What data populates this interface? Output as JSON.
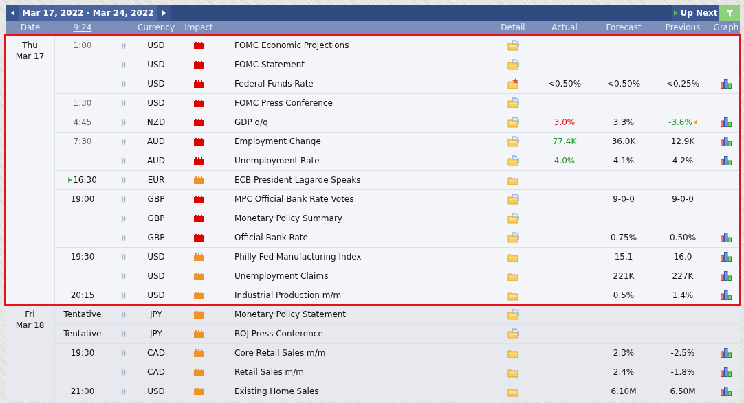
{
  "toolbar": {
    "date_range": "Mar 17, 2022 - Mar 24, 2022",
    "up_next": "Up Next"
  },
  "columns": [
    {
      "kind": "date",
      "label": "Date"
    },
    {
      "kind": "time",
      "label": "9:24"
    },
    {
      "kind": "currency",
      "label": "Currency"
    },
    {
      "kind": "impact",
      "label": "Impact"
    },
    {
      "kind": "detail",
      "label": "Detail"
    },
    {
      "kind": "actual",
      "label": "Actual"
    },
    {
      "kind": "forecast",
      "label": "Forecast"
    },
    {
      "kind": "previous",
      "label": "Previous"
    },
    {
      "kind": "graph",
      "label": "Graph"
    }
  ],
  "days": [
    {
      "weekday": "Thu",
      "date": "Mar 17",
      "highlighted": true,
      "slots": [
        {
          "time": "1:00",
          "past": true,
          "up_next": false,
          "events": [
            {
              "currency": "USD",
              "impact": {
                "color": "#e00000"
              },
              "title": "FOMC Economic Projections",
              "has_document": true,
              "starred": false,
              "graph": false
            },
            {
              "currency": "USD",
              "impact": {
                "color": "#e00000"
              },
              "title": "FOMC Statement",
              "has_document": true,
              "starred": false,
              "graph": false
            },
            {
              "currency": "USD",
              "impact": {
                "color": "#e00000"
              },
              "title": "Federal Funds Rate",
              "has_document": false,
              "starred": true,
              "actual": {
                "value": "<0.50%",
                "color": "#111111"
              },
              "forecast": "<0.50%",
              "previous": {
                "value": "<0.25%",
                "color": "#111111"
              },
              "revised": false,
              "graph": true
            }
          ]
        },
        {
          "time": "1:30",
          "past": true,
          "up_next": false,
          "events": [
            {
              "currency": "USD",
              "impact": {
                "color": "#e00000"
              },
              "title": "FOMC Press Conference",
              "has_document": true,
              "starred": false,
              "graph": false
            }
          ]
        },
        {
          "time": "4:45",
          "past": true,
          "up_next": false,
          "events": [
            {
              "currency": "NZD",
              "impact": {
                "color": "#e00000"
              },
              "title": "GDP q/q",
              "has_document": true,
              "starred": false,
              "actual": {
                "value": "3.0%",
                "color": "#e0141e"
              },
              "forecast": "3.3%",
              "previous": {
                "value": "-3.6%",
                "color": "#1a9a2a"
              },
              "revised": true,
              "graph": true
            }
          ]
        },
        {
          "time": "7:30",
          "past": true,
          "up_next": false,
          "events": [
            {
              "currency": "AUD",
              "impact": {
                "color": "#e00000"
              },
              "title": "Employment Change",
              "has_document": true,
              "starred": false,
              "actual": {
                "value": "77.4K",
                "color": "#1a9a2a"
              },
              "forecast": "36.0K",
              "previous": {
                "value": "12.9K",
                "color": "#111111"
              },
              "revised": false,
              "graph": true
            },
            {
              "currency": "AUD",
              "impact": {
                "color": "#e00000"
              },
              "title": "Unemployment Rate",
              "has_document": true,
              "starred": false,
              "actual": {
                "value": "4.0%",
                "color": "#1a9a2a"
              },
              "forecast": "4.1%",
              "previous": {
                "value": "4.2%",
                "color": "#111111"
              },
              "revised": false,
              "graph": true
            }
          ]
        },
        {
          "time": "16:30",
          "past": false,
          "up_next": true,
          "events": [
            {
              "currency": "EUR",
              "impact": {
                "color": "#f0922a"
              },
              "title": "ECB President Lagarde Speaks",
              "has_document": false,
              "starred": false,
              "graph": false
            }
          ]
        },
        {
          "time": "19:00",
          "past": false,
          "up_next": false,
          "events": [
            {
              "currency": "GBP",
              "impact": {
                "color": "#e00000"
              },
              "title": "MPC Official Bank Rate Votes",
              "has_document": true,
              "starred": false,
              "forecast": "9-0-0",
              "previous": {
                "value": "9-0-0",
                "color": "#111111"
              },
              "revised": false,
              "graph": false
            },
            {
              "currency": "GBP",
              "impact": {
                "color": "#e00000"
              },
              "title": "Monetary Policy Summary",
              "has_document": true,
              "starred": false,
              "graph": false
            },
            {
              "currency": "GBP",
              "impact": {
                "color": "#e00000"
              },
              "title": "Official Bank Rate",
              "has_document": true,
              "starred": false,
              "forecast": "0.75%",
              "previous": {
                "value": "0.50%",
                "color": "#111111"
              },
              "revised": false,
              "graph": true
            }
          ]
        },
        {
          "time": "19:30",
          "past": false,
          "up_next": false,
          "events": [
            {
              "currency": "USD",
              "impact": {
                "color": "#f0922a"
              },
              "title": "Philly Fed Manufacturing Index",
              "has_document": false,
              "starred": false,
              "forecast": "15.1",
              "previous": {
                "value": "16.0",
                "color": "#111111"
              },
              "revised": false,
              "graph": true
            },
            {
              "currency": "USD",
              "impact": {
                "color": "#f0922a"
              },
              "title": "Unemployment Claims",
              "has_document": false,
              "starred": false,
              "forecast": "221K",
              "previous": {
                "value": "227K",
                "color": "#111111"
              },
              "revised": false,
              "graph": true
            }
          ]
        },
        {
          "time": "20:15",
          "past": false,
          "up_next": false,
          "events": [
            {
              "currency": "USD",
              "impact": {
                "color": "#f0922a"
              },
              "title": "Industrial Production m/m",
              "has_document": false,
              "starred": false,
              "forecast": "0.5%",
              "previous": {
                "value": "1.4%",
                "color": "#111111"
              },
              "revised": false,
              "graph": true
            }
          ]
        }
      ]
    },
    {
      "weekday": "Fri",
      "date": "Mar 18",
      "highlighted": false,
      "slots": [
        {
          "time": "Tentative",
          "past": false,
          "up_next": false,
          "events": [
            {
              "currency": "JPY",
              "impact": {
                "color": "#f0922a"
              },
              "title": "Monetary Policy Statement",
              "has_document": true,
              "starred": false,
              "graph": false
            }
          ]
        },
        {
          "time": "Tentative",
          "past": false,
          "up_next": false,
          "events": [
            {
              "currency": "JPY",
              "impact": {
                "color": "#f0922a"
              },
              "title": "BOJ Press Conference",
              "has_document": true,
              "starred": false,
              "graph": false
            }
          ]
        },
        {
          "time": "19:30",
          "past": false,
          "up_next": false,
          "events": [
            {
              "currency": "CAD",
              "impact": {
                "color": "#f0922a"
              },
              "title": "Core Retail Sales m/m",
              "has_document": false,
              "starred": false,
              "forecast": "2.3%",
              "previous": {
                "value": "-2.5%",
                "color": "#111111"
              },
              "revised": false,
              "graph": true
            },
            {
              "currency": "CAD",
              "impact": {
                "color": "#f0922a"
              },
              "title": "Retail Sales m/m",
              "has_document": false,
              "starred": false,
              "forecast": "2.4%",
              "previous": {
                "value": "-1.8%",
                "color": "#111111"
              },
              "revised": false,
              "graph": true
            }
          ]
        },
        {
          "time": "21:00",
          "past": false,
          "up_next": false,
          "events": [
            {
              "currency": "USD",
              "impact": {
                "color": "#f0922a"
              },
              "title": "Existing Home Sales",
              "has_document": false,
              "starred": false,
              "forecast": "6.10M",
              "previous": {
                "value": "6.50M",
                "color": "#111111"
              },
              "revised": false,
              "graph": true
            }
          ]
        }
      ]
    }
  ]
}
